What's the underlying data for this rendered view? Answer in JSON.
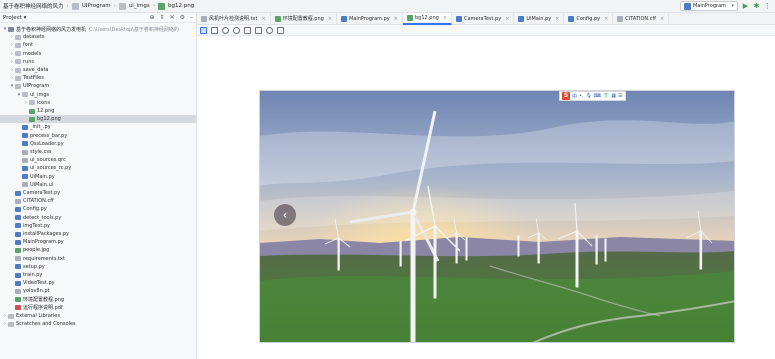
{
  "title_bar": {
    "project_name": "基于卷积神经网络的风力",
    "breadcrumb": [
      "UIProgram",
      "ui_imgs",
      "bg12.png"
    ],
    "run_config": "MainProgram"
  },
  "project_panel": {
    "label": "Project",
    "tree": [
      {
        "label": "基于卷积神经网络的风力发电机",
        "path": "C:\\Users\\Desktop\\基于卷积神经网络的",
        "depth": 0,
        "type": "root",
        "expanded": true
      },
      {
        "label": "datasets",
        "depth": 1,
        "type": "folder"
      },
      {
        "label": "font",
        "depth": 1,
        "type": "folder"
      },
      {
        "label": "models",
        "depth": 1,
        "type": "folder"
      },
      {
        "label": "runs",
        "depth": 1,
        "type": "folder"
      },
      {
        "label": "save_data",
        "depth": 1,
        "type": "folder"
      },
      {
        "label": "TestFiles",
        "depth": 1,
        "type": "folder"
      },
      {
        "label": "UIProgram",
        "depth": 1,
        "type": "folder",
        "expanded": true
      },
      {
        "label": "ui_imgs",
        "depth": 2,
        "type": "folder",
        "expanded": true
      },
      {
        "label": "icons",
        "depth": 3,
        "type": "folder"
      },
      {
        "label": "12.png",
        "depth": 3,
        "type": "img"
      },
      {
        "label": "bg12.png",
        "depth": 3,
        "type": "img",
        "selected": true
      },
      {
        "label": "_init_.py",
        "depth": 2,
        "type": "py"
      },
      {
        "label": "precess_bar.py",
        "depth": 2,
        "type": "py"
      },
      {
        "label": "QssLoader.py",
        "depth": 2,
        "type": "py"
      },
      {
        "label": "style.css",
        "depth": 2,
        "type": "txt"
      },
      {
        "label": "ui_sources.qrc",
        "depth": 2,
        "type": "txt"
      },
      {
        "label": "ui_sources_rc.py",
        "depth": 2,
        "type": "py"
      },
      {
        "label": "UiMain.py",
        "depth": 2,
        "type": "py"
      },
      {
        "label": "UiMain.ui",
        "depth": 2,
        "type": "txt"
      },
      {
        "label": "CameraTest.py",
        "depth": 1,
        "type": "py"
      },
      {
        "label": "CITATION.cff",
        "depth": 1,
        "type": "txt"
      },
      {
        "label": "Config.py",
        "depth": 1,
        "type": "py"
      },
      {
        "label": "detect_tools.py",
        "depth": 1,
        "type": "py"
      },
      {
        "label": "imgTest.py",
        "depth": 1,
        "type": "py"
      },
      {
        "label": "installPackages.py",
        "depth": 1,
        "type": "py"
      },
      {
        "label": "MainProgram.py",
        "depth": 1,
        "type": "py"
      },
      {
        "label": "people.jpg",
        "depth": 1,
        "type": "img"
      },
      {
        "label": "requirements.txt",
        "depth": 1,
        "type": "txt"
      },
      {
        "label": "setup.py",
        "depth": 1,
        "type": "py"
      },
      {
        "label": "train.py",
        "depth": 1,
        "type": "py"
      },
      {
        "label": "VideoTest.py",
        "depth": 1,
        "type": "py"
      },
      {
        "label": "yolov8n.pt",
        "depth": 1,
        "type": "txt"
      },
      {
        "label": "环境配置教程.png",
        "depth": 1,
        "type": "img"
      },
      {
        "label": "运行程序说明.pdf",
        "depth": 1,
        "type": "pdf"
      },
      {
        "label": "External Libraries",
        "depth": 0,
        "type": "folder"
      },
      {
        "label": "Scratches and Consoles",
        "depth": 0,
        "type": "folder"
      }
    ]
  },
  "editor_tabs": [
    {
      "label": "风机叶片检测说明.txt",
      "type": "txt"
    },
    {
      "label": "环境配置教程.png",
      "type": "img"
    },
    {
      "label": "MainProgram.py",
      "type": "py"
    },
    {
      "label": "bg12.png",
      "type": "img",
      "active": true
    },
    {
      "label": "CameraTest.py",
      "type": "py"
    },
    {
      "label": "UiMain.py",
      "type": "py"
    },
    {
      "label": "Config.py",
      "type": "py"
    },
    {
      "label": "CITATION.cff",
      "type": "txt"
    }
  ],
  "image_viewer": {
    "image_name": "bg12.png",
    "ime_toolbar": {
      "logo": "S",
      "label": "中"
    }
  },
  "colors": {
    "accent": "#3574f0",
    "selection": "#d5d8de"
  }
}
